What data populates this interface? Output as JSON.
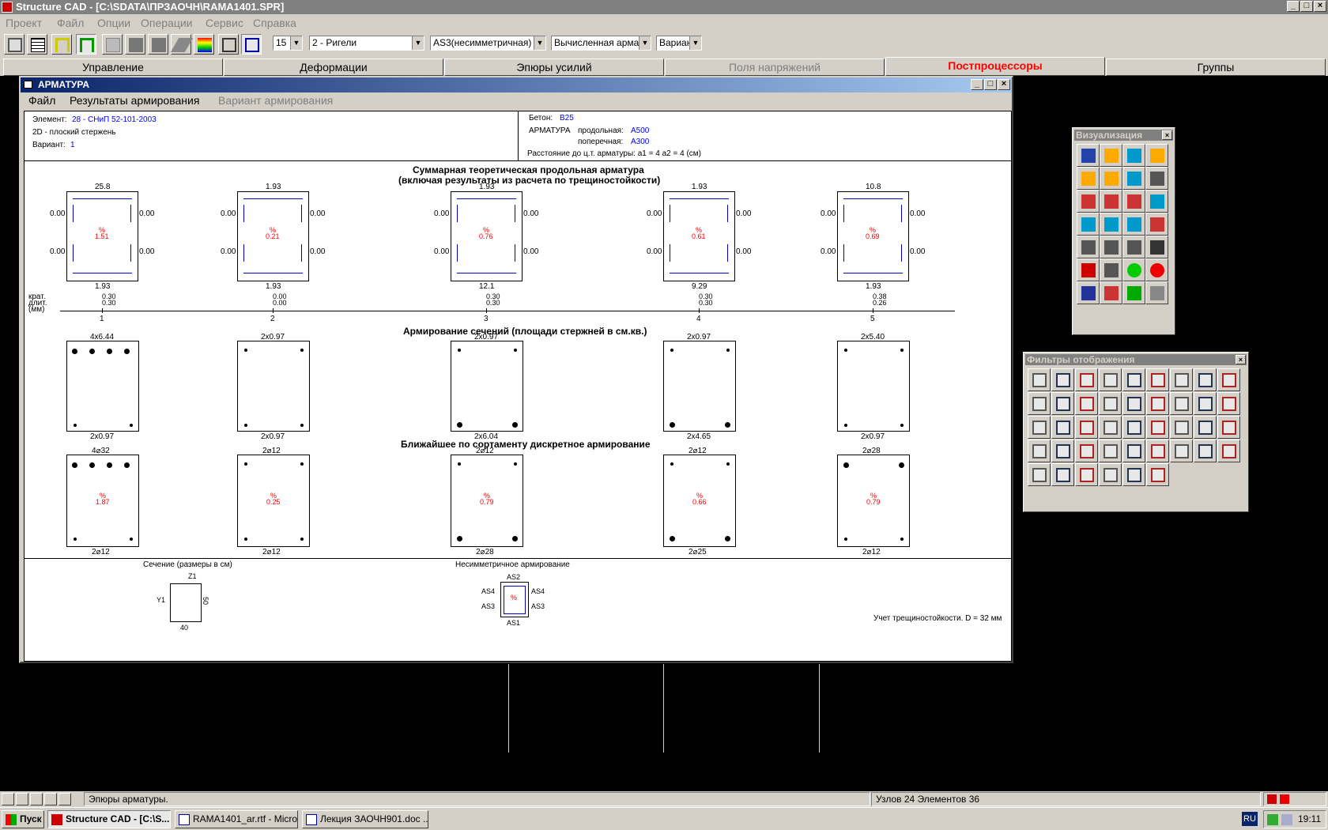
{
  "app": {
    "title": "Structure CAD  - [C:\\SDATA\\ПРЗАОЧН\\RAMA1401.SPR]",
    "menu": [
      "Проект",
      "Файл",
      "Опции",
      "Операции",
      "Сервис",
      "Справка"
    ]
  },
  "toolbar": {
    "combo1": "15",
    "combo2": "2 - Ригели",
    "combo3": "AS3(несимметричная)",
    "combo4": "Вычисленная армату",
    "combo5": "Вариан"
  },
  "tabs": [
    "Управление",
    "Деформации",
    "Эпюры усилий",
    "Поля напряжений",
    "Постпроцессоры",
    "Группы"
  ],
  "dialog": {
    "title": "АРМАТУРА",
    "menu": [
      "Файл",
      "Результаты армирования",
      "Вариант армирования"
    ],
    "info": {
      "element_label": "Элемент:",
      "element_value": "28 - СНиП 52-101-2003",
      "type": "2D - плоский стержень",
      "variant_label": "Вариант:",
      "variant_value": "1",
      "concrete_label": "Бетон:",
      "concrete_value": "B25",
      "rebar_label": "АРМАТУРА",
      "long_label": "продольная:",
      "long_value": "A500",
      "trans_label": "поперечная:",
      "trans_value": "A300",
      "distance": "Расстояние до ц.т. арматуры: a1 = 4  a2 = 4 (см)"
    },
    "heading1": "Суммарная теоретическая продольная арматура",
    "heading1b": "(включая результаты из расчета по трещиностойкости)",
    "heading2": "Армирование сечений (площади стержней в см.кв.)",
    "heading3": "Ближайшее по сортаменту дискретное армирование",
    "krat_labels": [
      "крат.",
      "длит.",
      "(мм)"
    ],
    "sections": [
      {
        "num": "1",
        "top": "25.8",
        "bottom": "1.93",
        "pct": "1.51",
        "left1": "0.00",
        "left2": "0.00",
        "right1": "0.00",
        "right2": "0.00",
        "krat": "0.30",
        "dlit": "0.30",
        "area_top": "4x6.44",
        "area_bot": "2x0.97",
        "disc_top": "4⌀32",
        "disc_bot": "2⌀12",
        "disc_pct": "1.87"
      },
      {
        "num": "2",
        "top": "1.93",
        "bottom": "1.93",
        "pct": "0.21",
        "left1": "0.00",
        "left2": "0.00",
        "right1": "0.00",
        "right2": "0.00",
        "krat": "0.00",
        "dlit": "0.00",
        "area_top": "2x0.97",
        "area_bot": "2x0.97",
        "disc_top": "2⌀12",
        "disc_bot": "2⌀12",
        "disc_pct": "0.25"
      },
      {
        "num": "3",
        "top": "1.93",
        "bottom": "12.1",
        "pct": "0.76",
        "left1": "0.00",
        "left2": "0.00",
        "right1": "0.00",
        "right2": "0.00",
        "krat": "0.30",
        "dlit": "0.30",
        "area_top": "2x0.97",
        "area_bot": "2x6.04",
        "disc_top": "2⌀12",
        "disc_bot": "2⌀28",
        "disc_pct": "0.79"
      },
      {
        "num": "4",
        "top": "1.93",
        "bottom": "9.29",
        "pct": "0.61",
        "left1": "0.00",
        "left2": "0.00",
        "right1": "0.00",
        "right2": "0.00",
        "krat": "0.30",
        "dlit": "0.30",
        "area_top": "2x0.97",
        "area_bot": "2x4.65",
        "disc_top": "2⌀12",
        "disc_bot": "2⌀25",
        "disc_pct": "0.66"
      },
      {
        "num": "5",
        "top": "10.8",
        "bottom": "1.93",
        "pct": "0.69",
        "left1": "0.00",
        "left2": "0.00",
        "right1": "0.00",
        "right2": "0.00",
        "krat": "0.38",
        "dlit": "0.26",
        "area_top": "2x5.40",
        "area_bot": "2x0.97",
        "disc_top": "2⌀28",
        "disc_bot": "2⌀12",
        "disc_pct": "0.79"
      }
    ],
    "pct_sign": "%",
    "legend": {
      "section_title": "Сечение (размеры в см)",
      "z1": "Z1",
      "y1": "Y1",
      "h": "50",
      "b": "40",
      "asym_title": "Несимметричное армирование",
      "as1": "AS1",
      "as2": "AS2",
      "as3": "AS3",
      "as4": "AS4",
      "crack": "Учет трещиностойкости. D = 32 мм"
    }
  },
  "palettes": {
    "viz_title": "Визуализация",
    "filter_title": "Фильтры отображения"
  },
  "status": {
    "text": "Эпюры арматуры.",
    "nodes": "Узлов 24 Элементов 36"
  },
  "taskbar": {
    "start": "Пуск",
    "tasks": [
      "Structure CAD - [C:\\S...",
      "RAMA1401_ar.rtf - Micro...",
      "Лекция ЗАОЧН901.doc ..."
    ],
    "lang": "RU",
    "time": "19:11"
  }
}
